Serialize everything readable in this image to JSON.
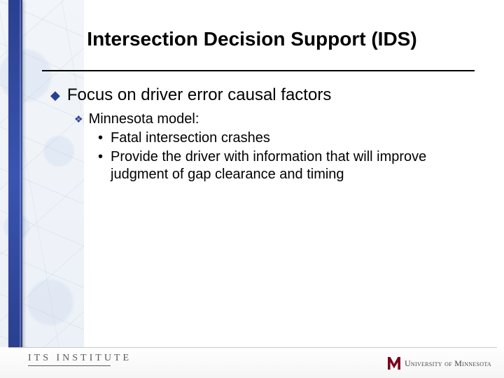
{
  "title": "Intersection Decision Support (IDS)",
  "content": {
    "l1": "Focus on driver error causal factors",
    "l2": "Minnesota model:",
    "l3a": "Fatal intersection crashes",
    "l3b": "Provide the driver with information that will improve judgment of gap clearance and timing"
  },
  "footer": {
    "its": "ITS INSTITUTE",
    "umn": "University of Minnesota"
  },
  "colors": {
    "accent": "#2a3f8f",
    "maroon": "#7a0019"
  }
}
